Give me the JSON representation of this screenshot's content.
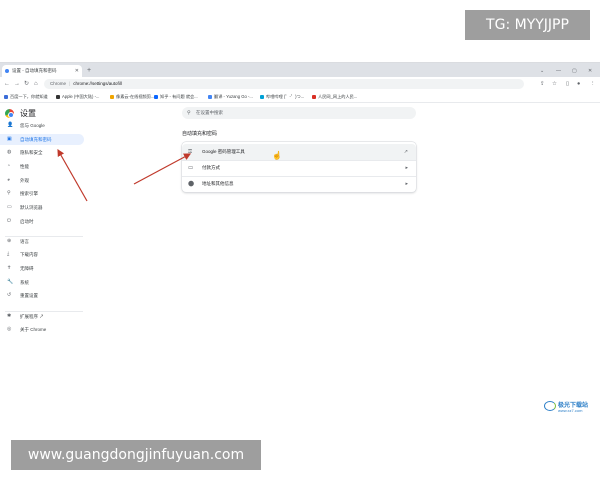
{
  "watermarks": {
    "top": "TG: MYYJJPP",
    "bottom": "www.guangdongjinfuyuan.com"
  },
  "browser": {
    "tab_title": "设置 - 自动填充和密码",
    "new_tab": "+",
    "url_chip": "Chrome",
    "url": "chrome://settings/autofill",
    "bookmarks": [
      {
        "label": "百度一下，你就知道",
        "color": "#3b6dd8"
      },
      {
        "label": "Apple (中国大陆) -...",
        "color": "#333333"
      },
      {
        "label": "像素云-在线视频剪...",
        "color": "#f0a500"
      },
      {
        "label": "知乎 - 有问题 就会...",
        "color": "#0a66ff"
      },
      {
        "label": "翻译 - Yuzang Go -...",
        "color": "#4285f4"
      },
      {
        "label": "哔哩哔哩 (゜-゜)つ...",
        "color": "#00a1d6"
      },
      {
        "label": "人民网_网上的人民...",
        "color": "#d93025"
      }
    ]
  },
  "settings": {
    "title": "设置",
    "search_placeholder": "在设置中搜索",
    "sidebar": [
      {
        "label": "您与 Google",
        "icon": "person-icon",
        "glyph": "👤",
        "active": false
      },
      {
        "label": "自动填充和密码",
        "icon": "autofill-icon",
        "glyph": "▣",
        "active": true
      },
      {
        "label": "隐私和安全",
        "icon": "shield-icon",
        "glyph": "◍",
        "active": false
      },
      {
        "label": "性能",
        "icon": "speed-icon",
        "glyph": "◔",
        "active": false
      },
      {
        "label": "外观",
        "icon": "palette-icon",
        "glyph": "◕",
        "active": false
      },
      {
        "label": "搜索引擎",
        "icon": "search-icon",
        "glyph": "⚲",
        "active": false
      },
      {
        "label": "默认浏览器",
        "icon": "browser-icon",
        "glyph": "▭",
        "active": false
      },
      {
        "label": "启动时",
        "icon": "power-icon",
        "glyph": "⏻",
        "active": false
      },
      {
        "label": "语言",
        "icon": "globe-icon",
        "glyph": "⊕",
        "active": false
      },
      {
        "label": "下载内容",
        "icon": "download-icon",
        "glyph": "⤓",
        "active": false
      },
      {
        "label": "无障碍",
        "icon": "accessibility-icon",
        "glyph": "✝",
        "active": false
      },
      {
        "label": "系统",
        "icon": "wrench-icon",
        "glyph": "🔧",
        "active": false
      },
      {
        "label": "重置设置",
        "icon": "reset-icon",
        "glyph": "↺",
        "active": false
      },
      {
        "label": "扩展程序",
        "icon": "extension-icon",
        "glyph": "✱",
        "active": false
      },
      {
        "label": "关于 Chrome",
        "icon": "chrome-icon",
        "glyph": "◎",
        "active": false
      }
    ],
    "section_title": "自动填充和密码",
    "rows": [
      {
        "label": "Google 密码管理工具",
        "icon": "key-icon",
        "glyph": "⚿",
        "end": "↗",
        "end_icon": "external-link-icon"
      },
      {
        "label": "付款方式",
        "icon": "credit-card-icon",
        "glyph": "▭",
        "end": "▸",
        "end_icon": "chevron-right-icon"
      },
      {
        "label": "地址和其他信息",
        "icon": "location-icon",
        "glyph": "⬤",
        "end": "▸",
        "end_icon": "chevron-right-icon"
      }
    ]
  },
  "logo_br": {
    "line1": "极光下载站",
    "line2": "www.xz7.com"
  },
  "colors": {
    "accent": "#1a73e8",
    "arrow": "#c0392b"
  }
}
